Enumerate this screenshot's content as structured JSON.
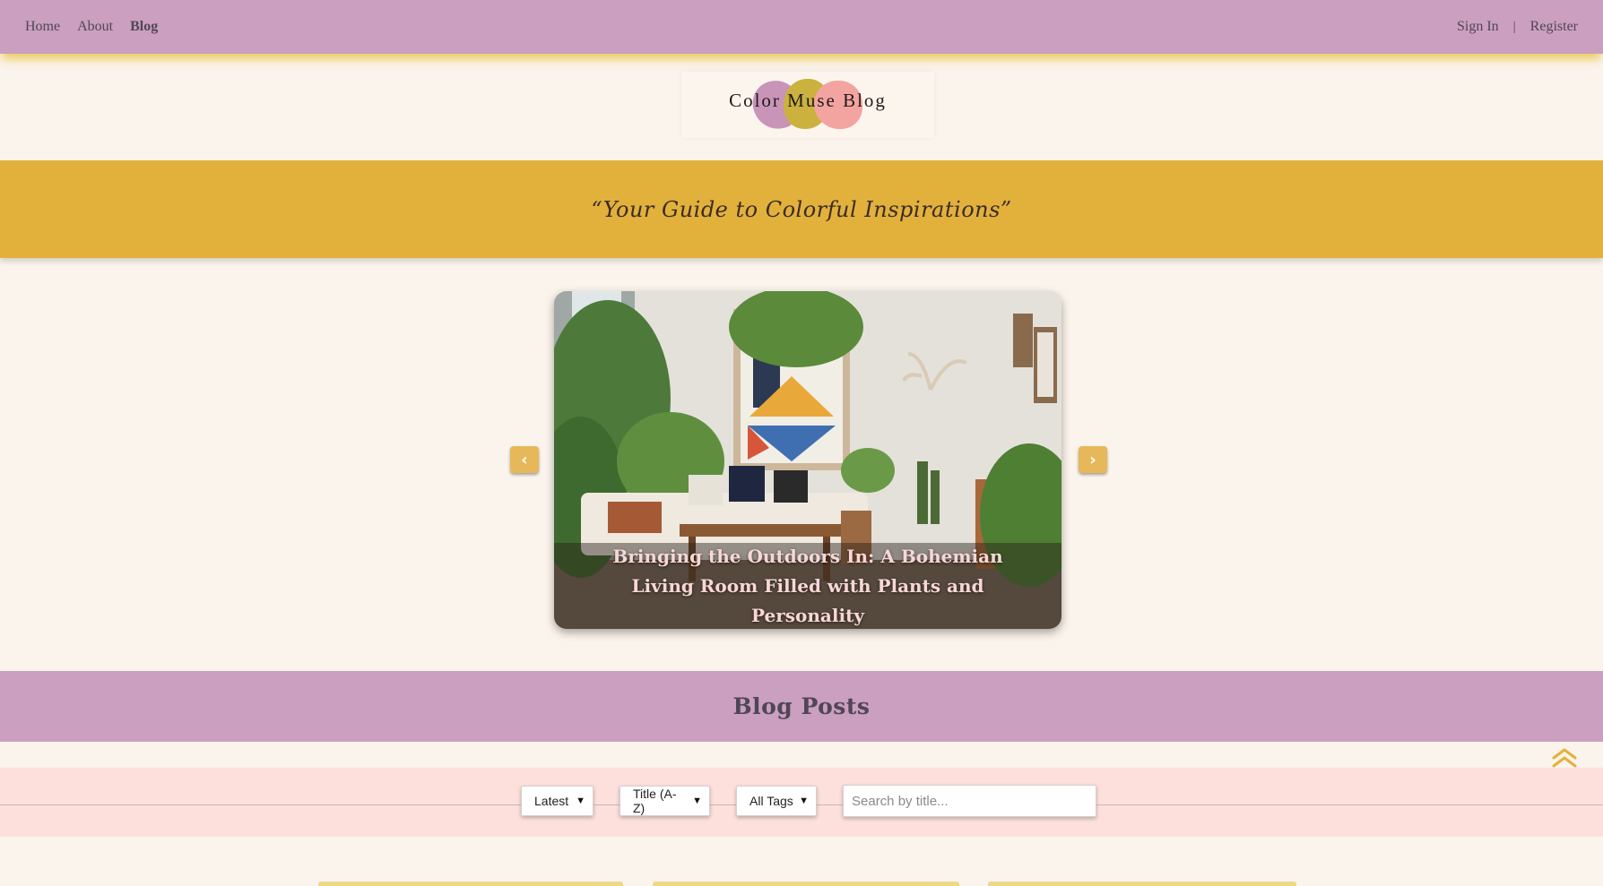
{
  "nav": {
    "links": [
      {
        "label": "Home"
      },
      {
        "label": "About"
      },
      {
        "label": "Blog",
        "active": true
      }
    ],
    "sign_in": "Sign In",
    "separator": "|",
    "register": "Register"
  },
  "logo": {
    "text": "Color Muse Blog",
    "blob_colors": [
      "#c894b8",
      "#cbb23f",
      "#f3a4a0"
    ]
  },
  "tagline": "“Your Guide to Colorful Inspirations”",
  "carousel": {
    "caption": "Bringing the Outdoors In: A Bohemian Living Room Filled with Plants and Personality",
    "prev_icon": "chevron-left-icon",
    "next_icon": "chevron-right-icon",
    "prev_glyph": "‹",
    "next_glyph": "›"
  },
  "posts_section": {
    "title": "Blog Posts"
  },
  "filters": {
    "sort": {
      "selected": "Latest"
    },
    "title_sort": {
      "selected": "Title (A-Z)"
    },
    "tags": {
      "selected": "All Tags"
    },
    "search": {
      "placeholder": "Search by title...",
      "value": ""
    }
  },
  "colors": {
    "nav_bg": "#cb9fbf",
    "tagline_bg": "#e2b13c",
    "page_bg": "#fbf4ec",
    "filter_bg": "#fde0dc",
    "accent": "#e6b85a"
  }
}
